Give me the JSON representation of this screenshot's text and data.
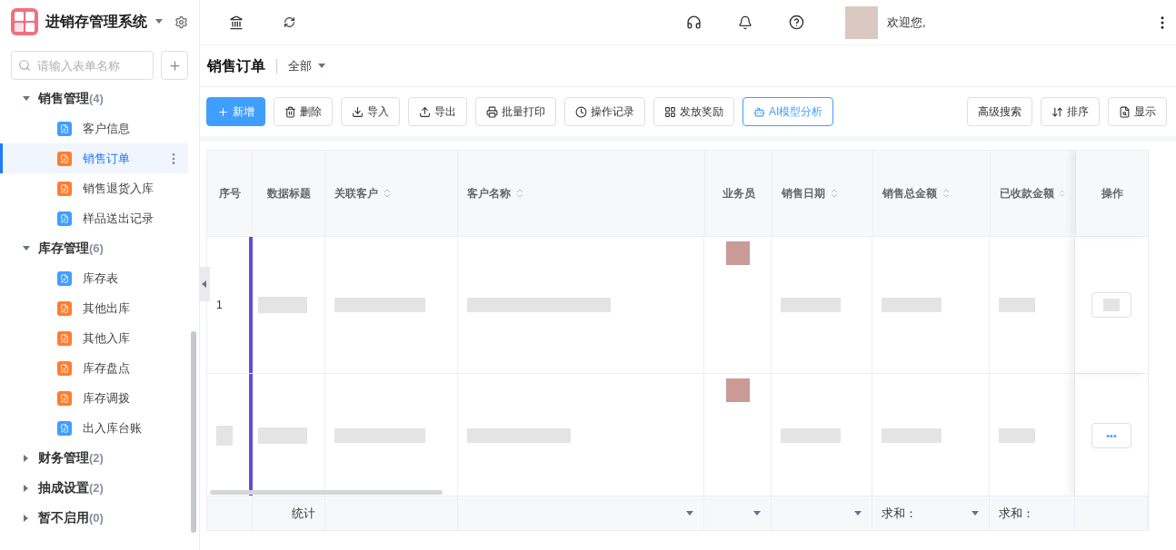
{
  "app": {
    "title": "进销存管理系统"
  },
  "sidebar": {
    "search": {
      "placeholder": "请输入表单名称"
    },
    "groups": [
      {
        "label": "销售管理",
        "count": "(4)",
        "expanded": true,
        "children": [
          {
            "label": "客户信息",
            "color": "#409eff",
            "selected": false
          },
          {
            "label": "销售订单",
            "color": "#ff7d2e",
            "selected": true
          },
          {
            "label": "销售退货入库",
            "color": "#ff7d2e",
            "selected": false
          },
          {
            "label": "样品送出记录",
            "color": "#409eff",
            "selected": false
          }
        ]
      },
      {
        "label": "库存管理",
        "count": "(6)",
        "expanded": true,
        "children": [
          {
            "label": "库存表",
            "color": "#409eff",
            "selected": false
          },
          {
            "label": "其他出库",
            "color": "#ff7d2e",
            "selected": false
          },
          {
            "label": "其他入库",
            "color": "#ff7d2e",
            "selected": false
          },
          {
            "label": "库存盘点",
            "color": "#ff7d2e",
            "selected": false
          },
          {
            "label": "库存调拨",
            "color": "#ff7d2e",
            "selected": false
          },
          {
            "label": "出入库台账",
            "color": "#409eff",
            "selected": false
          }
        ]
      },
      {
        "label": "财务管理",
        "count": "(2)",
        "expanded": false
      },
      {
        "label": "抽成设置",
        "count": "(2)",
        "expanded": false
      },
      {
        "label": "暂不启用",
        "count": "(0)",
        "expanded": false
      }
    ]
  },
  "topbar": {
    "greeting": "欢迎您,"
  },
  "page": {
    "title": "销售订单",
    "filter": "全部"
  },
  "toolbar": {
    "actions": [
      {
        "label": "新增",
        "kind": "add"
      },
      {
        "label": "删除",
        "kind": "delete"
      },
      {
        "label": "导入",
        "kind": "import"
      },
      {
        "label": "导出",
        "kind": "export"
      },
      {
        "label": "批量打印",
        "kind": "print"
      },
      {
        "label": "操作记录",
        "kind": "history"
      },
      {
        "label": "发放奖励",
        "kind": "reward"
      },
      {
        "label": "AI模型分析",
        "kind": "ai"
      }
    ],
    "view": [
      {
        "label": "高级搜索",
        "kind": "search"
      },
      {
        "label": "排序",
        "kind": "sort"
      },
      {
        "label": "显示",
        "kind": "display"
      }
    ]
  },
  "table": {
    "columns": [
      {
        "label": "序号",
        "sortable": false
      },
      {
        "label": "数据标题",
        "sortable": false
      },
      {
        "label": "关联客户",
        "sortable": true
      },
      {
        "label": "客户名称",
        "sortable": true
      },
      {
        "label": "业务员",
        "sortable": false
      },
      {
        "label": "销售日期",
        "sortable": true
      },
      {
        "label": "销售总金额",
        "sortable": true
      },
      {
        "label": "已收款金额",
        "sortable": true
      },
      {
        "label": "操作",
        "sortable": false
      }
    ],
    "rows": [
      {
        "index": "1"
      },
      {
        "action": "•••"
      }
    ],
    "footer": {
      "label": "统计",
      "sums": [
        "求和：",
        "求和："
      ]
    }
  }
}
